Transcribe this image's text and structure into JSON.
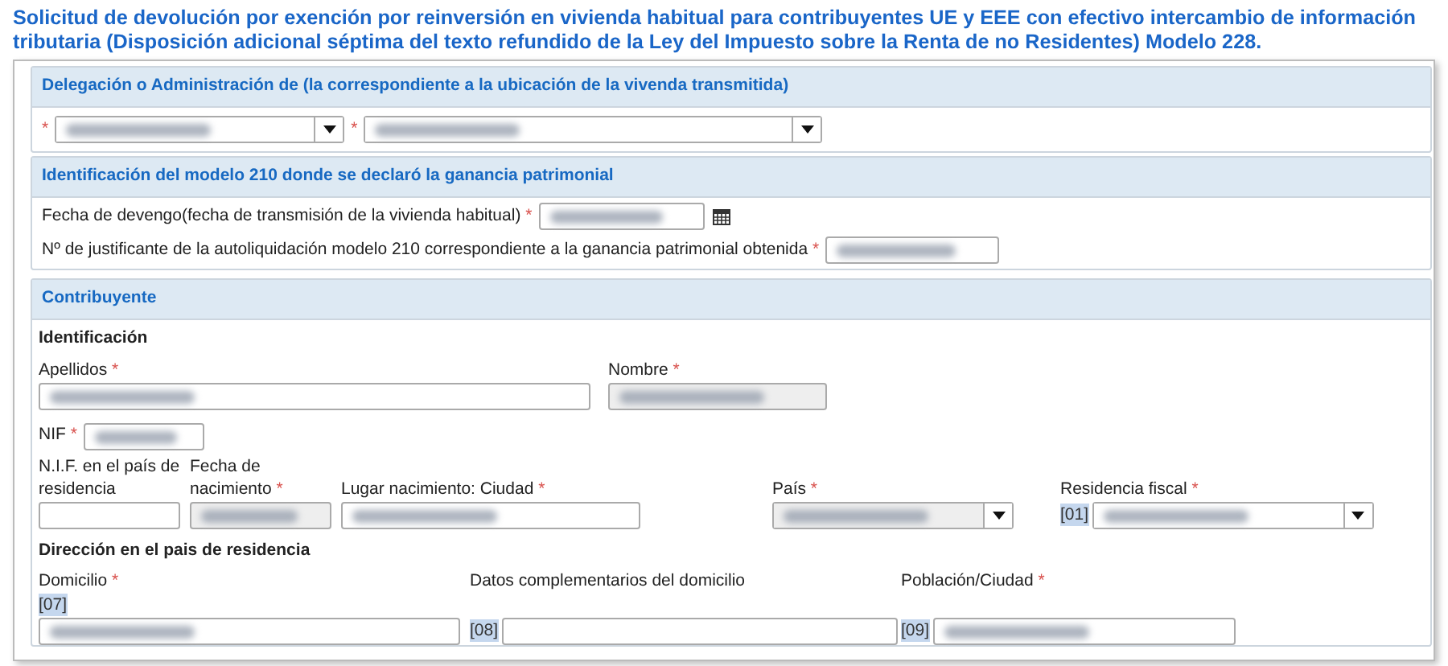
{
  "title": "Solicitud de devolución por exención por reinversión en vivienda habitual para contribuyentes UE y EEE con efectivo intercambio de información tributaria (Disposición adicional séptima del texto refundido de la Ley del Impuesto sobre la Renta de no Residentes) Modelo 228.",
  "required_mark": "*",
  "delegacion": {
    "title": "Delegación o Administración de (la correspondiente a la ubicación de la vivenda transmitida)",
    "selects": [
      {
        "required": true,
        "filled": true,
        "disabled": false
      },
      {
        "required": true,
        "filled": true,
        "disabled": false
      }
    ]
  },
  "modelo_210": {
    "title": "Identificación del modelo 210 donde se declaró la ganancia patrimonial",
    "fields": [
      {
        "kind": "date",
        "label": "Fecha de devengo(fecha de transmisión de la vivienda habitual)",
        "required": true,
        "filled": true
      },
      {
        "kind": "text",
        "label": "Nº de justificante de la autoliquidación modelo 210 correspondiente a la ganancia patrimonial obtenida",
        "required": true,
        "filled": true
      }
    ]
  },
  "contribuyente": {
    "title": "Contribuyente",
    "subheading": "Identificación",
    "fields": [
      {
        "kind": "text",
        "label": "Apellidos",
        "required": true,
        "filled": true,
        "disabled": false
      },
      {
        "kind": "text",
        "label": "Nombre",
        "required": true,
        "filled": true,
        "disabled": true
      },
      {
        "kind": "text",
        "label": "NIF",
        "required": true,
        "filled": true,
        "disabled": false
      },
      {
        "kind": "text",
        "label": "N.I.F. en el país de residencia",
        "required": false,
        "filled": false,
        "disabled": false
      },
      {
        "kind": "text",
        "label": "Fecha de nacimiento",
        "required": true,
        "filled": true,
        "disabled": true
      },
      {
        "kind": "text",
        "label": "Lugar nacimiento: Ciudad",
        "required": true,
        "filled": true,
        "disabled": false
      },
      {
        "kind": "select",
        "label": "País",
        "required": true,
        "filled": true,
        "disabled": true
      },
      {
        "kind": "select",
        "label": "Residencia fiscal",
        "required": true,
        "filled": true,
        "disabled": false,
        "code": "[01]"
      }
    ],
    "address_heading": "Dirección en el pais de residencia",
    "address_fields": [
      {
        "kind": "text",
        "label": "Domicilio",
        "required": true,
        "filled": true,
        "disabled": false,
        "code": "[07]"
      },
      {
        "kind": "text",
        "label": "Datos complementarios del domicilio",
        "required": false,
        "filled": false,
        "disabled": false,
        "code": "[08]"
      },
      {
        "kind": "text",
        "label": "Población/Ciudad",
        "required": true,
        "filled": true,
        "disabled": false,
        "code": "[09]"
      }
    ]
  }
}
